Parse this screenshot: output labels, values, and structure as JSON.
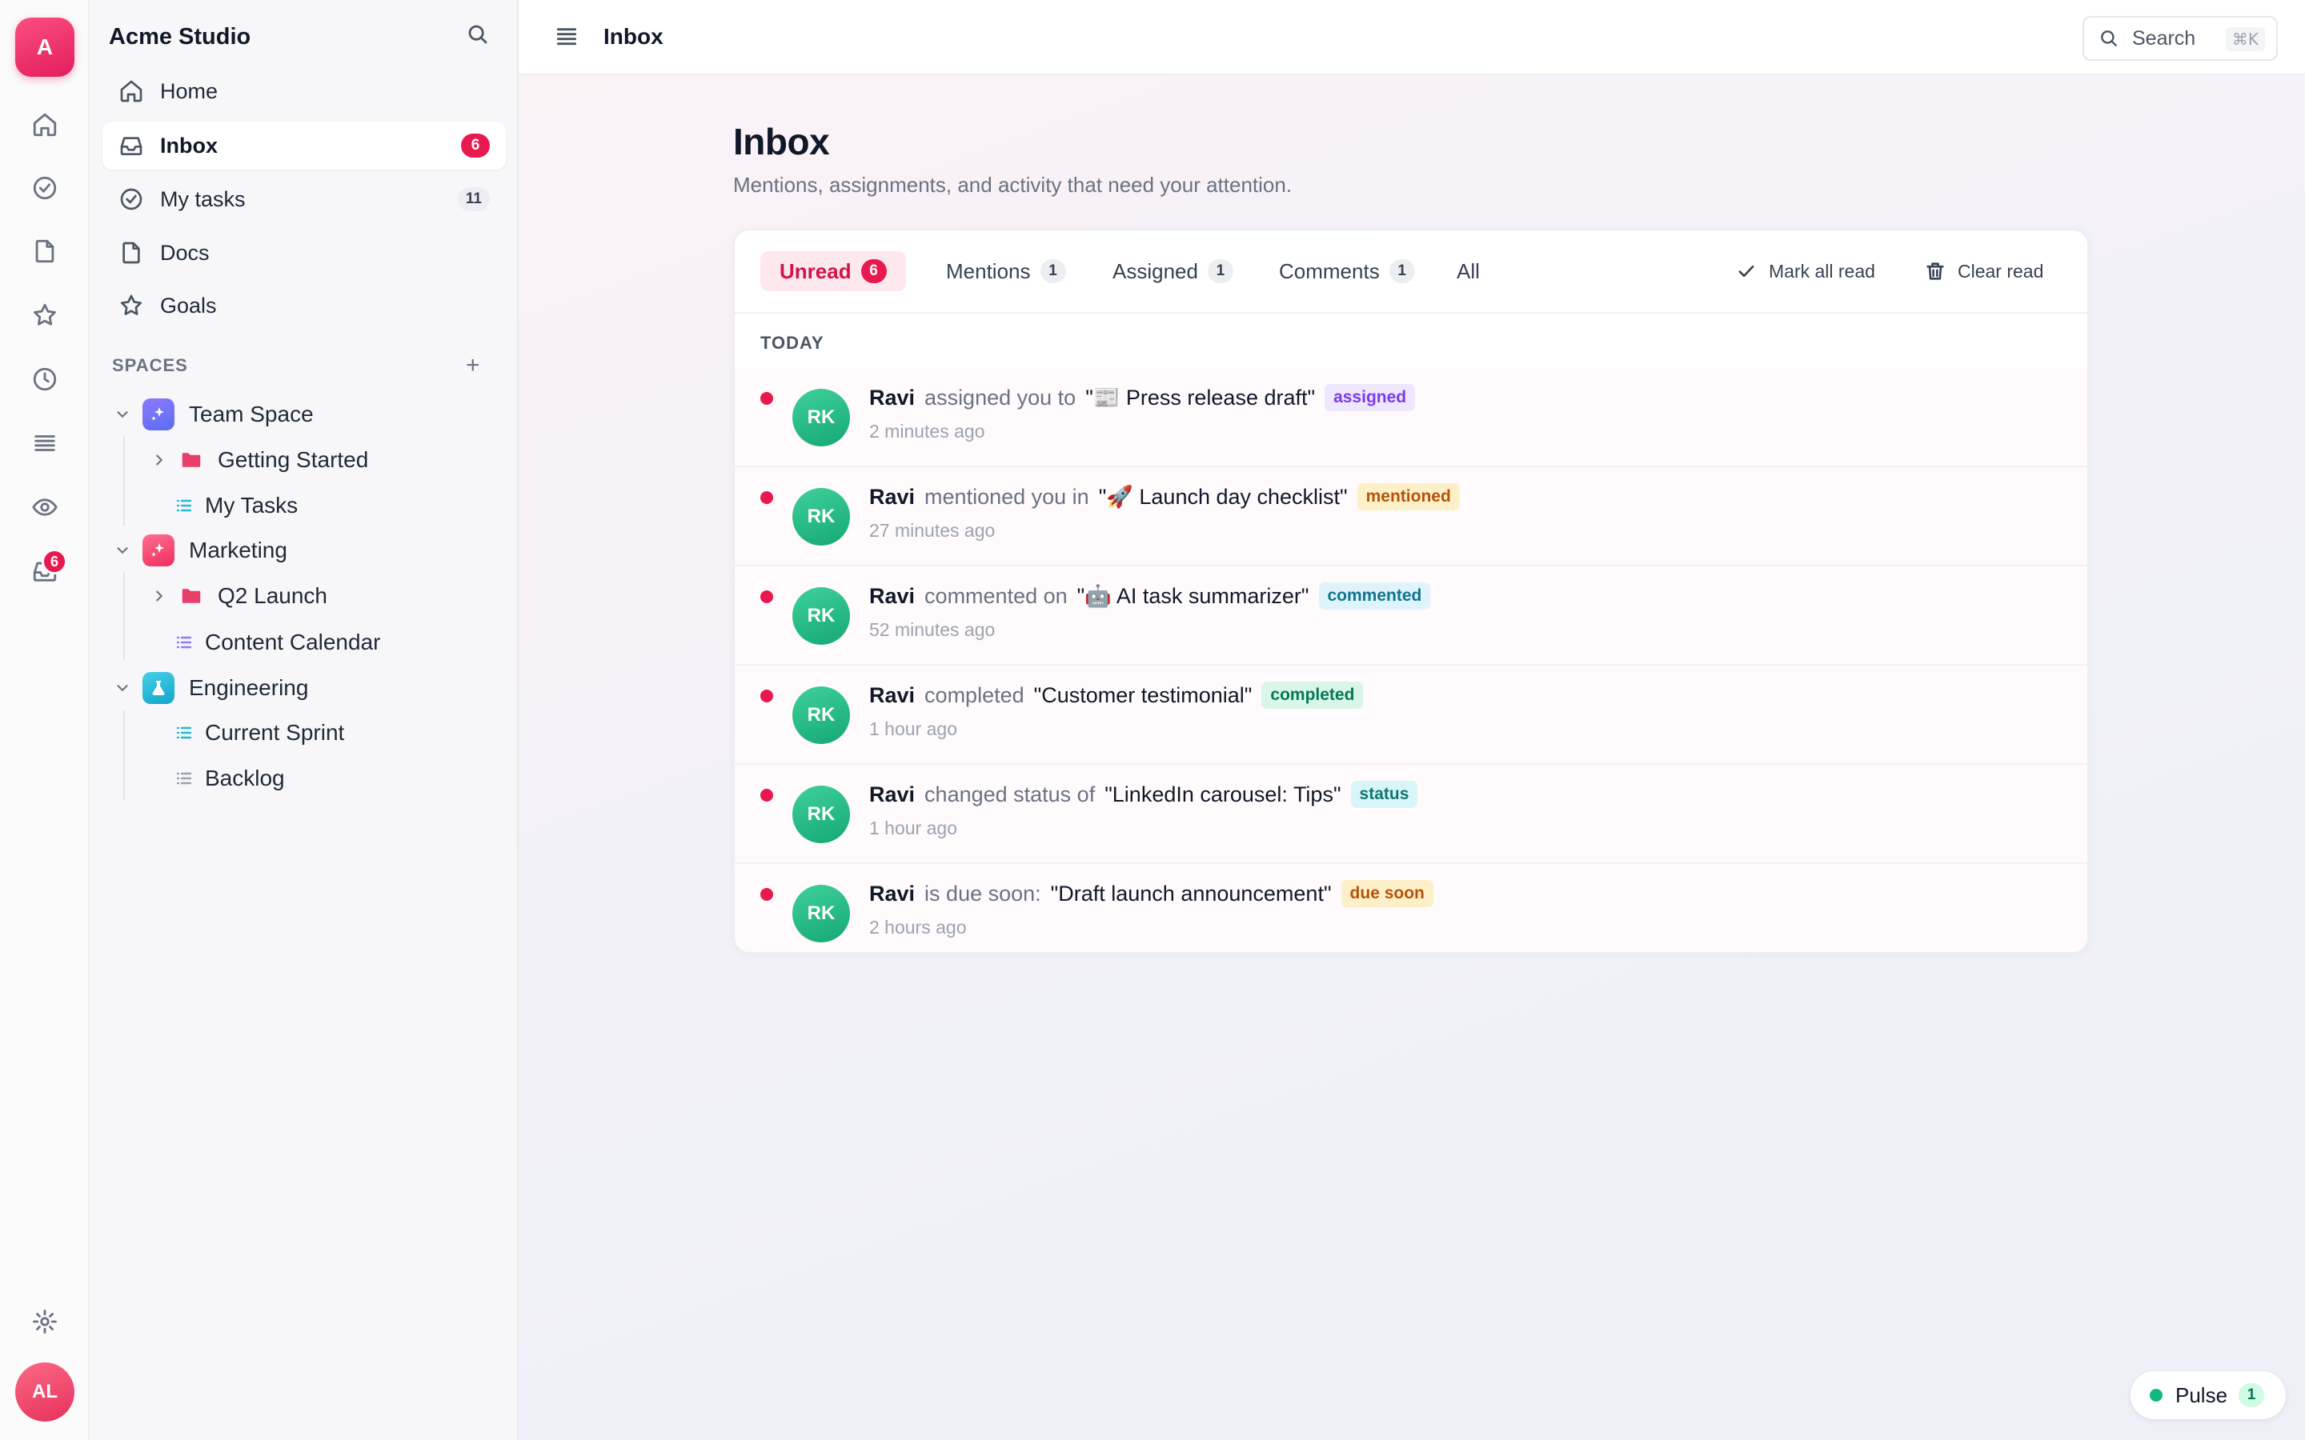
{
  "rail": {
    "logo_letter": "A",
    "inbox_badge": "6",
    "user_initials": "AL"
  },
  "sidebar": {
    "workspace_name": "Acme Studio",
    "nav": [
      {
        "label": "Home",
        "icon": "home-icon",
        "count": ""
      },
      {
        "label": "Inbox",
        "icon": "inbox-icon",
        "count": "6"
      },
      {
        "label": "My tasks",
        "icon": "check-circle-icon",
        "count": "11"
      },
      {
        "label": "Docs",
        "icon": "document-icon",
        "count": ""
      },
      {
        "label": "Goals",
        "icon": "star-icon",
        "count": ""
      }
    ],
    "spaces_header": "SPACES",
    "spaces_add": "+",
    "spaces": [
      {
        "name": "Team Space",
        "color": "#7c6cf5",
        "children": [
          "Getting Started",
          "My Tasks"
        ]
      },
      {
        "name": "Marketing",
        "color": "#f4466e",
        "children": [
          "Q2 Launch",
          "Content Calendar"
        ]
      },
      {
        "name": "Engineering",
        "color": "#22b8d8",
        "children": [
          "Current Sprint",
          "Backlog"
        ]
      }
    ]
  },
  "topbar": {
    "title": "Inbox",
    "search_label": "Search",
    "search_shortcut": "⌘K"
  },
  "main": {
    "title": "Inbox",
    "subtitle": "Mentions, assignments, and activity that need your attention.",
    "tabs": [
      {
        "label": "Unread",
        "count": "6"
      },
      {
        "label": "Mentions",
        "count": "1"
      },
      {
        "label": "Assigned",
        "count": "1"
      },
      {
        "label": "Comments",
        "count": "1"
      },
      {
        "label": "All",
        "count": ""
      }
    ],
    "actions": {
      "mark_all_read": "Mark all read",
      "clear_read": "Clear read"
    },
    "group_label": "TODAY",
    "notifications": [
      {
        "initials": "RK",
        "actor": "Ravi",
        "verb": "assigned you to",
        "target": "\"📰 Press release draft\"",
        "tag": "assigned",
        "tag_bg": "#efe7fd",
        "tag_fg": "#7c3aed",
        "time": "2 minutes ago"
      },
      {
        "initials": "RK",
        "actor": "Ravi",
        "verb": "mentioned you in",
        "target": "\"🚀 Launch day checklist\"",
        "tag": "mentioned",
        "tag_bg": "#fdf0c9",
        "tag_fg": "#b45309",
        "time": "27 minutes ago"
      },
      {
        "initials": "RK",
        "actor": "Ravi",
        "verb": "commented on",
        "target": "\"🤖 AI task summarizer\"",
        "tag": "commented",
        "tag_bg": "#dff3fb",
        "tag_fg": "#0e7490",
        "time": "52 minutes ago"
      },
      {
        "initials": "RK",
        "actor": "Ravi",
        "verb": "completed",
        "target": "\"Customer testimonial\"",
        "tag": "completed",
        "tag_bg": "#d9f7e8",
        "tag_fg": "#047857",
        "time": "1 hour ago"
      },
      {
        "initials": "RK",
        "actor": "Ravi",
        "verb": "changed status of",
        "target": "\"LinkedIn carousel: Tips\"",
        "tag": "status",
        "tag_bg": "#d8f6f7",
        "tag_fg": "#0f766e",
        "time": "1 hour ago"
      },
      {
        "initials": "RK",
        "actor": "Ravi",
        "verb": "is due soon:",
        "target": "\"Draft launch announcement\"",
        "tag": "due soon",
        "tag_bg": "#fdf0c9",
        "tag_fg": "#b45309",
        "time": "2 hours ago"
      }
    ]
  },
  "pulse": {
    "label": "Pulse",
    "count": "1"
  },
  "colors": {
    "accent": "#e8194f",
    "avatar_green": "#16a874"
  }
}
